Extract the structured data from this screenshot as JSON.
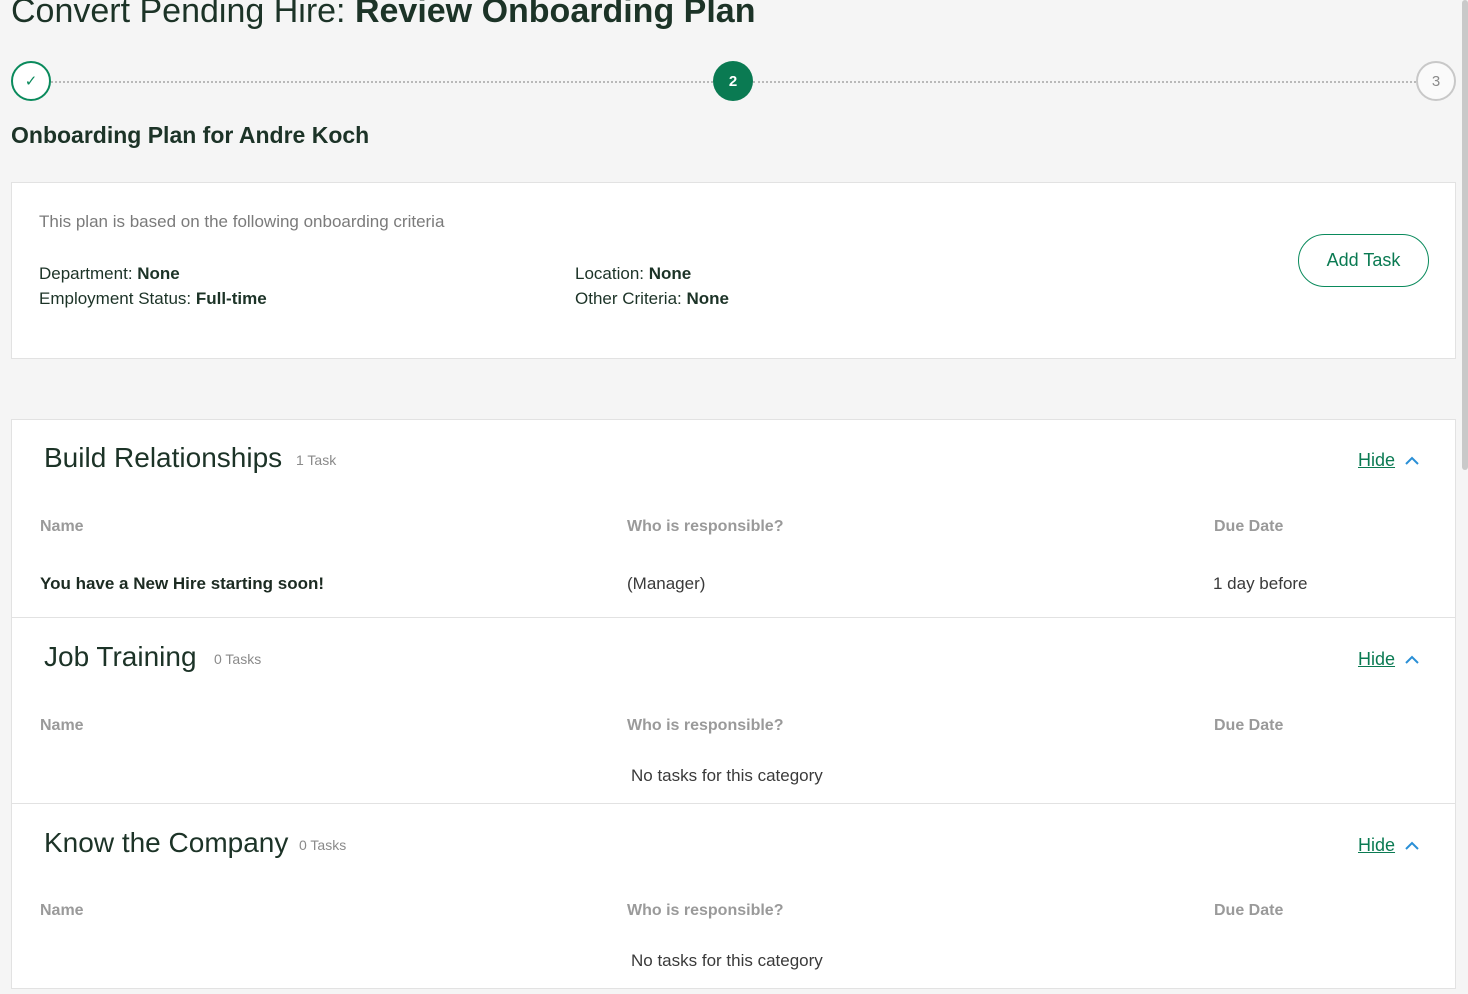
{
  "title": {
    "prefix": "Convert Pending Hire: ",
    "bold": "Review Onboarding Plan"
  },
  "stepper": {
    "steps": [
      {
        "label": "✓",
        "state": "done"
      },
      {
        "label": "2",
        "state": "current"
      },
      {
        "label": "3",
        "state": "upcoming"
      }
    ]
  },
  "plan_heading": "Onboarding Plan for Andre Koch",
  "criteria": {
    "intro": "This plan is based on the following onboarding criteria",
    "department_label": "Department: ",
    "department_value": "None",
    "employment_label": "Employment Status: ",
    "employment_value": "Full-time",
    "location_label": "Location: ",
    "location_value": "None",
    "other_label": "Other Criteria: ",
    "other_value": "None",
    "add_task_label": "Add Task"
  },
  "columns": {
    "name": "Name",
    "responsible": "Who is responsible?",
    "due": "Due Date"
  },
  "categories": [
    {
      "title": "Build Relationships",
      "count": "1 Task",
      "hide_label": "Hide",
      "tasks": [
        {
          "name": "You have a New Hire starting soon!",
          "responsible": "(Manager)",
          "due": "1 day before"
        }
      ],
      "empty_message": ""
    },
    {
      "title": "Job Training",
      "count": "0 Tasks",
      "hide_label": "Hide",
      "tasks": [],
      "empty_message": "No tasks for this category"
    },
    {
      "title": "Know the Company",
      "count": "0 Tasks",
      "hide_label": "Hide",
      "tasks": [],
      "empty_message": "No tasks for this category"
    }
  ],
  "colors": {
    "accent": "#0a7a52",
    "heading": "#1c3327",
    "muted": "#9a9a9a"
  }
}
